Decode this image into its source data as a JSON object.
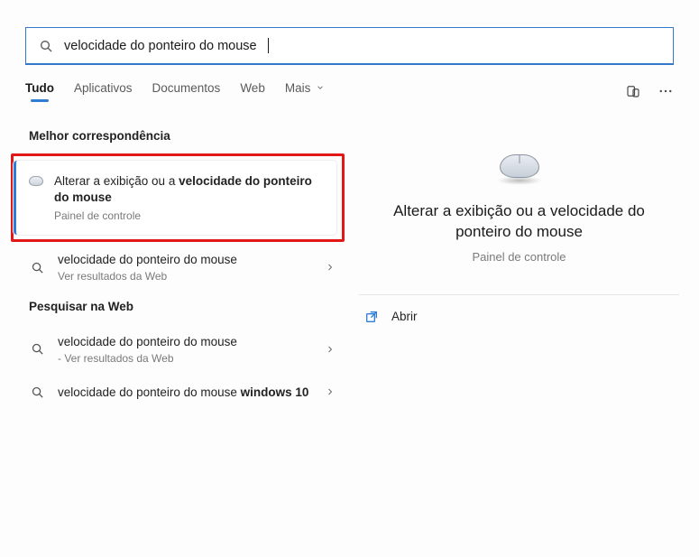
{
  "search": {
    "query": "velocidade do ponteiro do mouse"
  },
  "tabs": {
    "all": "Tudo",
    "apps": "Aplicativos",
    "docs": "Documentos",
    "web": "Web",
    "more": "Mais"
  },
  "sections": {
    "best": "Melhor correspondência",
    "web": "Pesquisar na Web"
  },
  "best_match": {
    "title_prefix": "Alterar a exibição ou a ",
    "title_bold": "velocidade do ponteiro do mouse",
    "subtitle": "Painel de controle"
  },
  "results": {
    "r1_title": "velocidade do ponteiro do mouse",
    "r1_sub": "Ver resultados da Web",
    "r2_title": "velocidade do ponteiro do mouse",
    "r2_sub": "- Ver resultados da Web",
    "r3_prefix": "velocidade do ponteiro do mouse ",
    "r3_bold": "windows 10"
  },
  "preview": {
    "title": "Alterar a exibição ou a velocidade do ponteiro do mouse",
    "subtitle": "Painel de controle",
    "open_label": "Abrir"
  }
}
